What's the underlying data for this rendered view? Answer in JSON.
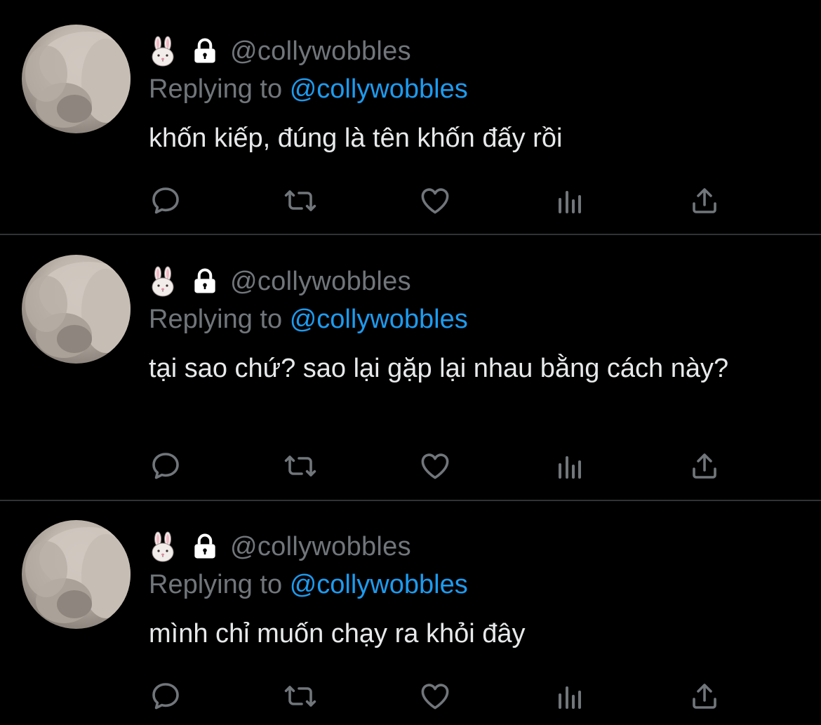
{
  "colors": {
    "background": "#000000",
    "divider": "#2f3336",
    "muted_text": "#71767b",
    "link_blue": "#1d9bf0",
    "body_text": "#e7e9ea",
    "icon_gray": "#71767b"
  },
  "tweets": [
    {
      "author_emoji": "🐰",
      "locked": true,
      "handle": "@collywobbles",
      "replying_prefix": "Replying to",
      "replying_to": "@collywobbles",
      "text": "khốn kiếp, đúng là tên khốn đấy rồi",
      "actions": [
        "reply-icon",
        "retweet-icon",
        "heart-icon",
        "views-icon",
        "share-icon"
      ]
    },
    {
      "author_emoji": "🐰",
      "locked": true,
      "handle": "@collywobbles",
      "replying_prefix": "Replying to",
      "replying_to": "@collywobbles",
      "text": "tại sao chứ? sao lại gặp lại nhau bằng cách này?",
      "actions": [
        "reply-icon",
        "retweet-icon",
        "heart-icon",
        "views-icon",
        "share-icon"
      ]
    },
    {
      "author_emoji": "🐰",
      "locked": true,
      "handle": "@collywobbles",
      "replying_prefix": "Replying to",
      "replying_to": "@collywobbles",
      "text": "mình chỉ muốn chạy ra khỏi đây",
      "actions": [
        "reply-icon",
        "retweet-icon",
        "heart-icon",
        "views-icon",
        "share-icon"
      ]
    }
  ]
}
